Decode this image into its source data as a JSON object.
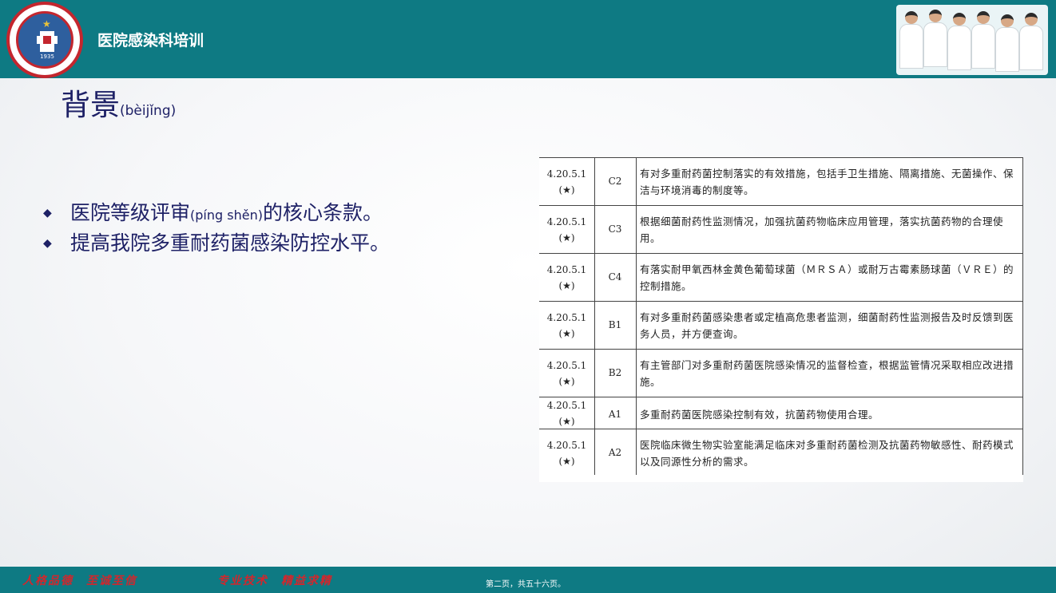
{
  "header": {
    "title": "医院感染科培训",
    "logo_year": "1935"
  },
  "section": {
    "title": "背景",
    "title_pinyin": "(bèijǐng)"
  },
  "bullets": [
    {
      "pre": "医院等级评审",
      "pinyin": "(píng shěn)",
      "post": "的核心条款。"
    },
    {
      "pre": "提高我院多重耐药菌感染防控水平。",
      "pinyin": "",
      "post": ""
    }
  ],
  "table": {
    "rows": [
      {
        "code": "4.20.5.1",
        "star": "(★)",
        "level": "C2",
        "text": "有对多重耐药菌控制落实的有效措施，包括手卫生措施、隔离措施、无菌操作、保洁与环境消毒的制度等。"
      },
      {
        "code": "4.20.5.1",
        "star": "(★)",
        "level": "C3",
        "text": "根据细菌耐药性监测情况，加强抗菌药物临床应用管理，落实抗菌药物的合理使用。"
      },
      {
        "code": "4.20.5.1",
        "star": "(★)",
        "level": "C4",
        "text": "有落实耐甲氧西林金黄色葡萄球菌（ＭＲＳＡ）或耐万古霉素肠球菌（ＶＲＥ）的控制措施。"
      },
      {
        "code": "4.20.5.1",
        "star": "(★)",
        "level": "B1",
        "text": "有对多重耐药菌感染患者或定植高危患者监测，细菌耐药性监测报告及时反馈到医务人员，并方便查询。"
      },
      {
        "code": "4.20.5.1",
        "star": "(★)",
        "level": "B2",
        "text": "有主管部门对多重耐药菌医院感染情况的监督检查，根据监管情况采取相应改进措施。"
      },
      {
        "code": "4.20.5.1",
        "star": "(★)",
        "level": "A1",
        "text": "多重耐药菌医院感染控制有效，抗菌药物使用合理。"
      },
      {
        "code": "4.20.5.1",
        "star": "(★)",
        "level": "A2",
        "text": "医院临床微生物实验室能满足临床对多重耐药菌检测及抗菌药物敏感性、耐药模式以及同源性分析的需求。"
      }
    ]
  },
  "footer": {
    "motto_left": "人格品德　至诚至信",
    "motto_right": "专业技术　精益求精",
    "page": "第二页，共五十六页。"
  },
  "colors": {
    "header_bg": "#0e7a83",
    "title_text": "#1e2166",
    "motto": "#d3262c"
  }
}
